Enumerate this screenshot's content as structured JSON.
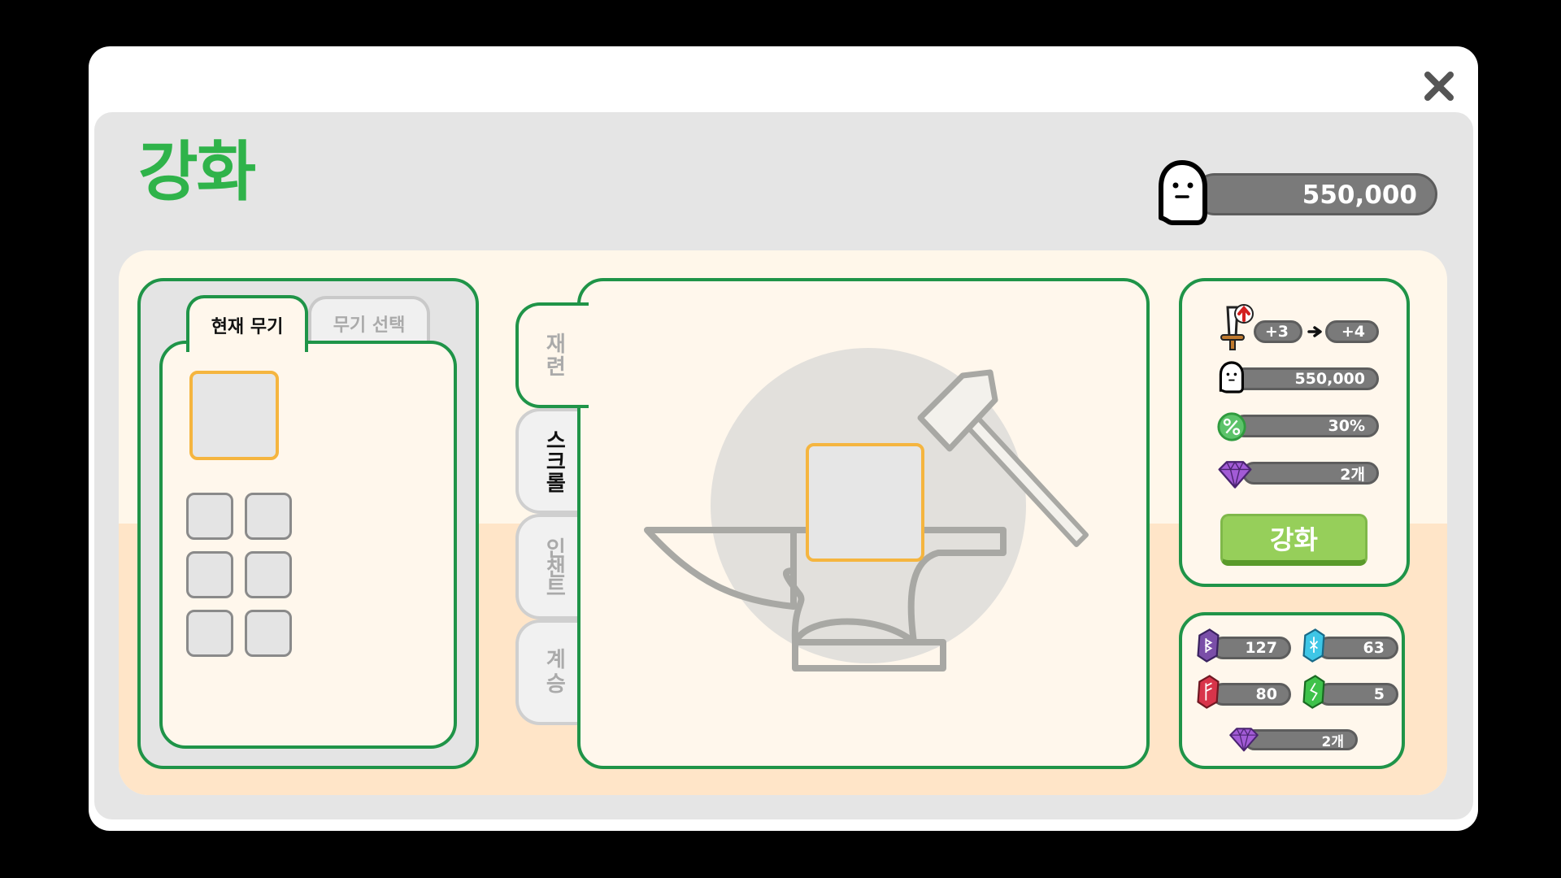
{
  "window": {
    "title": "강화",
    "close_icon": "close-icon"
  },
  "currency": {
    "amount": "550,000",
    "icon": "ghost-coin-icon"
  },
  "weapon_tabs": [
    {
      "label": "현재 무기",
      "active": true
    },
    {
      "label": "무기 선택",
      "active": false
    }
  ],
  "side_tabs": [
    {
      "label": "재련",
      "active": false
    },
    {
      "label": "스크롤",
      "active": true
    },
    {
      "label": "인챈트",
      "active": false
    },
    {
      "label": "계승",
      "active": false
    }
  ],
  "stats": {
    "level_from": "+3",
    "level_to": "+4",
    "cost": "550,000",
    "success_rate": "30%",
    "gem_cost": "2개",
    "enhance_label": "강화"
  },
  "materials": {
    "purple_rune": "127",
    "blue_rune": "63",
    "red_rune": "80",
    "green_rune": "5",
    "gem": "2개"
  },
  "colors": {
    "title_green": "#2fb34a",
    "border_green": "#1f9448",
    "highlight_orange": "#f5b53f",
    "button_green": "#96cf5a"
  }
}
